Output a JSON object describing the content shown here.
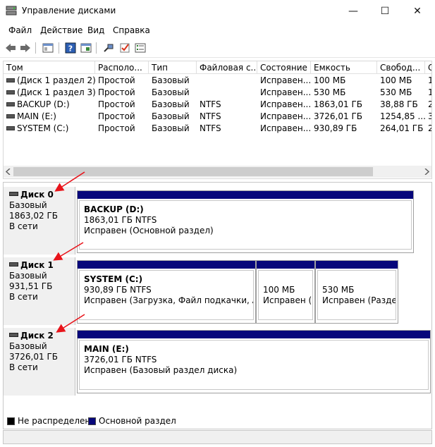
{
  "window": {
    "title": "Управление дисками",
    "minimize": "—",
    "maximize": "☐",
    "close": "✕"
  },
  "menu": [
    "Файл",
    "Действие",
    "Вид",
    "Справка"
  ],
  "table": {
    "columns": [
      "Том",
      "Располо...",
      "Тип",
      "Файловая с...",
      "Состояние",
      "Емкость",
      "Свобод...",
      "С"
    ],
    "rows": [
      [
        "(Диск 1 раздел 2)",
        "Простой",
        "Базовый",
        "",
        "Исправен...",
        "100 МБ",
        "100 МБ",
        "1"
      ],
      [
        "(Диск 1 раздел 3)",
        "Простой",
        "Базовый",
        "",
        "Исправен...",
        "530 МБ",
        "530 МБ",
        "1"
      ],
      [
        "BACKUP (D:)",
        "Простой",
        "Базовый",
        "NTFS",
        "Исправен...",
        "1863,01 ГБ",
        "38,88 ГБ",
        "2"
      ],
      [
        "MAIN (E:)",
        "Простой",
        "Базовый",
        "NTFS",
        "Исправен...",
        "3726,01 ГБ",
        "1254,85 ...",
        "3"
      ],
      [
        "SYSTEM (C:)",
        "Простой",
        "Базовый",
        "NTFS",
        "Исправен...",
        "930,89 ГБ",
        "264,01 ГБ",
        "2"
      ]
    ]
  },
  "disks": [
    {
      "name": "Диск 0",
      "type": "Базовый",
      "size": "1863,02 ГБ",
      "status": "В сети"
    },
    {
      "name": "Диск 1",
      "type": "Базовый",
      "size": "931,51 ГБ",
      "status": "В сети"
    },
    {
      "name": "Диск 2",
      "type": "Базовый",
      "size": "3726,01 ГБ",
      "status": "В сети"
    }
  ],
  "partitions": {
    "d0p1": {
      "name": "BACKUP  (D:)",
      "size": "1863,01 ГБ NTFS",
      "status": "Исправен (Основной раздел)"
    },
    "d1p1": {
      "name": "SYSTEM  (C:)",
      "size": "930,89 ГБ NTFS",
      "status": "Исправен (Загрузка, Файл подкачки, Авари"
    },
    "d1p2": {
      "size": "100 МБ",
      "status": "Исправен (Ц"
    },
    "d1p3": {
      "size": "530 МБ",
      "status": "Исправен (Раздел"
    },
    "d2p1": {
      "name": "MAIN  (E:)",
      "size": "3726,01 ГБ NTFS",
      "status": "Исправен (Базовый раздел диска)"
    }
  },
  "legend": {
    "unallocated": "Не распределена",
    "primary": "Основной раздел"
  },
  "colors": {
    "primary": "#07077b",
    "unallocated": "#000000",
    "arrow": "#e8141b"
  }
}
